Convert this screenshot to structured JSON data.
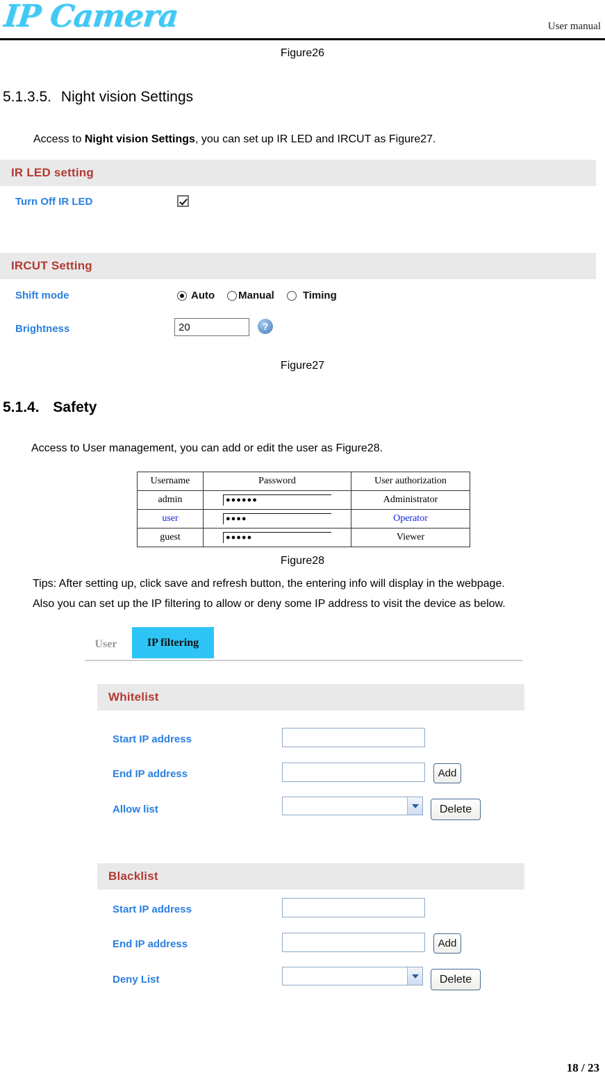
{
  "header": {
    "logo_text": "IP Camera",
    "right_label": "User manual"
  },
  "figures": {
    "fig26": "Figure26",
    "fig27": "Figure27",
    "fig28": "Figure28"
  },
  "sections": {
    "night_vision": {
      "number": "5.1.3.5.",
      "title": "Night vision Settings",
      "intro_pre": "Access to ",
      "intro_bold": "Night vision Settings",
      "intro_post": ", you can set up IR LED and IRCUT as Figure27."
    },
    "safety": {
      "number": "5.1.4.",
      "title": "Safety",
      "intro": "Access to User management, you can add or edit the user as Figure28.",
      "tips_line1": "Tips: After setting up, click save and refresh button, the entering info will display in the webpage.",
      "tips_line2": "Also you can set up the IP filtering to allow or deny some IP address to visit the device as below."
    }
  },
  "ir_led_panel": {
    "heading": "IR LED setting",
    "turn_off_label": "Turn Off IR LED",
    "turn_off_checked": true
  },
  "ircut_panel": {
    "heading": "IRCUT Setting",
    "shift_mode_label": "Shift mode",
    "shift_mode_options": [
      "Auto",
      "Manual",
      "Timing"
    ],
    "shift_mode_selected": "Auto",
    "brightness_label": "Brightness",
    "brightness_value": "20",
    "help_icon_text": "?"
  },
  "user_table": {
    "columns": [
      "Username",
      "Password",
      "User authorization"
    ],
    "rows": [
      {
        "username": "admin",
        "password_mask": "●●●●●●",
        "authorization": "Administrator",
        "highlight": false
      },
      {
        "username": "user",
        "password_mask": "●●●●",
        "authorization": "Operator",
        "highlight": true
      },
      {
        "username": "guest",
        "password_mask": "●●●●●",
        "authorization": "Viewer",
        "highlight": false
      }
    ]
  },
  "ip_filtering": {
    "tabs": [
      {
        "label": "User",
        "active": false
      },
      {
        "label": "IP filtering",
        "active": true
      }
    ],
    "active_tab_color": "#2ec4f5",
    "whitelist": {
      "heading": "Whitelist",
      "start_ip_label": "Start IP address",
      "start_ip_value": "",
      "end_ip_label": "End IP address",
      "end_ip_value": "",
      "list_label": "Allow list",
      "list_value": "",
      "add_button": "Add",
      "delete_button": "Delete"
    },
    "blacklist": {
      "heading": "Blacklist",
      "start_ip_label": "Start IP address",
      "start_ip_value": "",
      "end_ip_label": "End IP address",
      "end_ip_value": "",
      "list_label": "Deny List",
      "list_value": "",
      "add_button": "Add",
      "delete_button": "Delete"
    }
  },
  "footer": {
    "page_number": "18 / 23"
  }
}
